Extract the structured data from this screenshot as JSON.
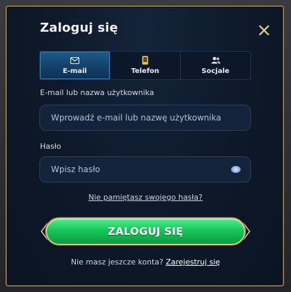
{
  "dialog": {
    "title": "Zaloguj się",
    "close_icon": "close-x-icon"
  },
  "tabs": [
    {
      "label": "E-mail",
      "icon": "envelope-icon",
      "active": true
    },
    {
      "label": "Telefon",
      "icon": "phone-icon",
      "active": false
    },
    {
      "label": "Socjale",
      "icon": "users-icon",
      "active": false
    }
  ],
  "form": {
    "email_label": "E-mail lub nazwa użytkownika",
    "email_placeholder": "Wprowadź e-mail lub nazwę użytkownika",
    "email_value": "",
    "password_label": "Hasło",
    "password_placeholder": "Wpisz hasło",
    "password_value": "",
    "forgot_link": "Nie pamiętasz swojego hasła?",
    "login_button": "ZALOGUJ SIĘ",
    "no_account_text": "Nie masz jeszcze konta?",
    "register_link": "Zarejestruj się"
  },
  "colors": {
    "accent_gold": "#d8c690",
    "button_green": "#18c65c",
    "active_tab_blue": "#1c5b8a",
    "panel_bg": "#0d1829"
  }
}
